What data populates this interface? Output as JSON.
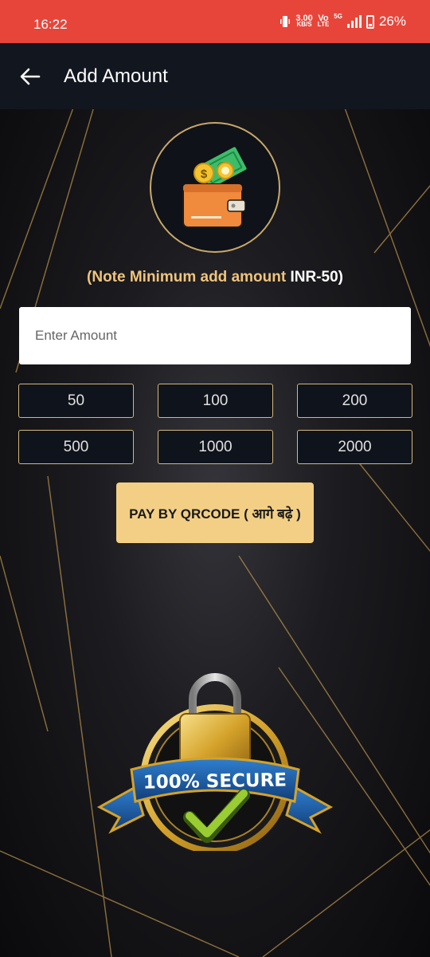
{
  "status_bar": {
    "time": "16:22",
    "speed_value": "3.00",
    "speed_unit": "KB/S",
    "volte_top": "Vo",
    "volte_bottom": "LTE",
    "network": "5G",
    "battery": "26%"
  },
  "app_bar": {
    "title": "Add Amount",
    "back_icon": "arrow-left-icon"
  },
  "wallet_icon": "wallet-icon",
  "note": {
    "prefix": "(Note Minimum add amount ",
    "amount": "INR-50)"
  },
  "amount_input": {
    "placeholder": "Enter Amount",
    "value": ""
  },
  "presets": [
    "50",
    "100",
    "200",
    "500",
    "1000",
    "2000"
  ],
  "pay_button": {
    "label": "PAY BY QRCODE ( आगे बढ़े )"
  },
  "secure_badge": {
    "text": "100% SECURE"
  },
  "colors": {
    "status_bar": "#e8453a",
    "app_bar": "#12161f",
    "accent_gold": "#f0c47c",
    "button": "#f3cf86"
  }
}
